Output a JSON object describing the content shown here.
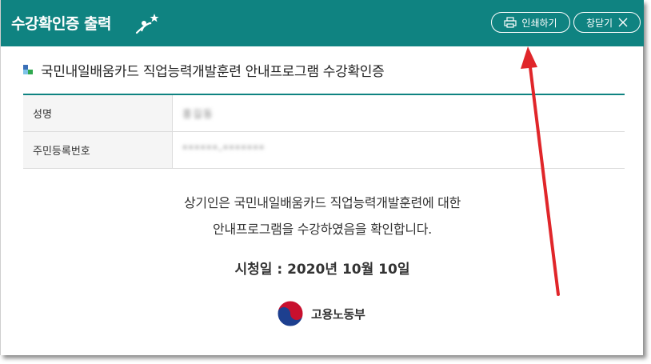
{
  "titlebar": {
    "title": "수강확인증 출력",
    "print_label": "인쇄하기",
    "close_label": "창닫기"
  },
  "document": {
    "heading": "국민내일배움카드 직업능력개발훈련 안내프로그램 수강확인증",
    "fields": [
      {
        "label": "성명",
        "value": "홍길동"
      },
      {
        "label": "주민등록번호",
        "value": "******-*******"
      }
    ],
    "statement_line1": "상기인은 국민내일배움카드 직업능력개발훈련에 대한",
    "statement_line2": "안내프로그램을 수강하였음을 확인합니다.",
    "date_line": "시청일 : 2020년 10월 10일",
    "ministry": "고용노동부"
  },
  "colors": {
    "accent": "#0f8381",
    "annotation_arrow": "#e0262a"
  },
  "icons": {
    "print": "printer-icon",
    "close": "close-x-icon",
    "logo": "ministry-emblem-icon",
    "title_logo": "flying-person-star-logo"
  }
}
